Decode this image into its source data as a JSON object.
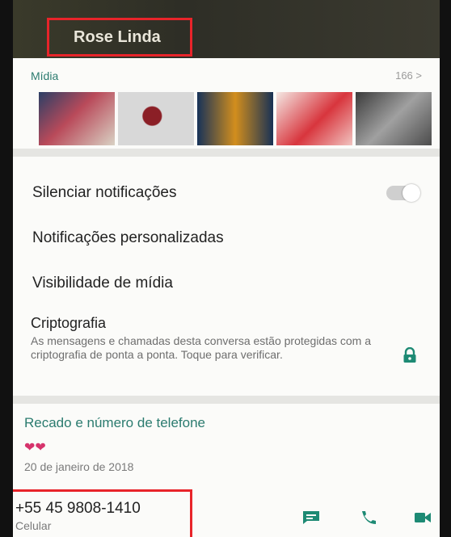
{
  "header": {
    "contact_name": "Rose Linda"
  },
  "media": {
    "label": "Mídia",
    "count": "166 >"
  },
  "settings": {
    "mute": "Silenciar notificações",
    "custom_notifications": "Notificações personalizadas",
    "media_visibility": "Visibilidade de mídia",
    "encryption_title": "Criptografia",
    "encryption_desc": "As mensagens e chamadas desta conversa estão protegidas com a criptografia de ponta a ponta. Toque para verificar."
  },
  "about": {
    "title": "Recado e número de telefone",
    "date": "20 de janeiro de 2018",
    "phone": "+55 45 9808-1410",
    "phone_type": "Celular"
  },
  "colors": {
    "accent": "#2b7b6f",
    "highlight": "#e8242a",
    "icon_green": "#1d8a74"
  },
  "icons": [
    "heart-icon",
    "lock-icon",
    "message-icon",
    "call-icon",
    "video-call-icon"
  ]
}
